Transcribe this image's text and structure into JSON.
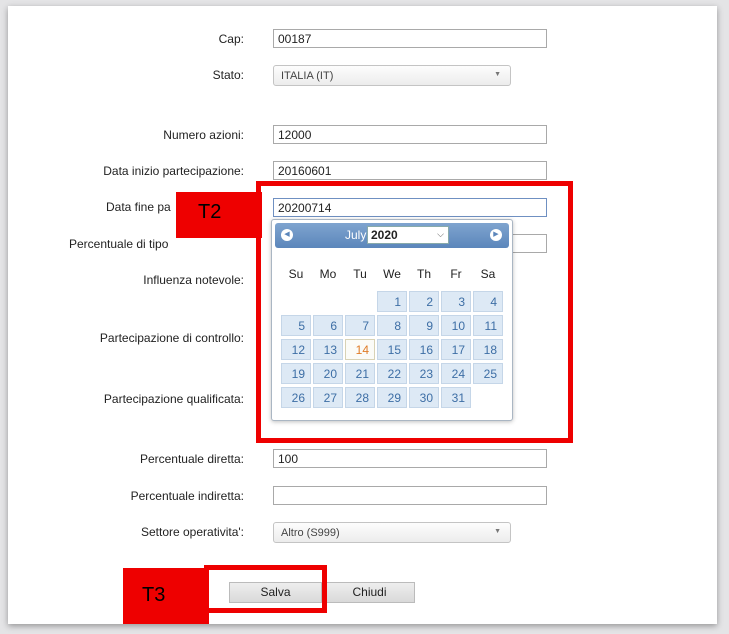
{
  "form": {
    "cap": {
      "label": "Cap:",
      "value": "00187"
    },
    "stato": {
      "label": "Stato:",
      "value": "ITALIA (IT)"
    },
    "numero_azioni": {
      "label": "Numero azioni:",
      "value": "12000"
    },
    "data_inizio": {
      "label": "Data inizio partecipazione:",
      "value": "20160601"
    },
    "data_fine": {
      "label": "Data fine pa",
      "value": "20200714"
    },
    "percentuale_tipo": {
      "label": "Percentuale di tipo"
    },
    "influenza": {
      "label": "Influenza notevole:"
    },
    "controllo": {
      "label": "Partecipazione di controllo:"
    },
    "qualificata": {
      "label": "Partecipazione qualificata:"
    },
    "perc_diretta": {
      "label": "Percentuale diretta:",
      "value": "100"
    },
    "perc_indiretta": {
      "label": "Percentuale indiretta:",
      "value": ""
    },
    "settore": {
      "label": "Settore operativita':",
      "value": "Altro (S999)"
    }
  },
  "buttons": {
    "save": "Salva",
    "close": "Chiudi"
  },
  "annotations": {
    "t2": "T2",
    "t3": "T3",
    "color": "#ee0000"
  },
  "datepicker": {
    "month": "July",
    "year": "2020",
    "weekdays": [
      "Su",
      "Mo",
      "Tu",
      "We",
      "Th",
      "Fr",
      "Sa"
    ],
    "weeks": [
      [
        null,
        null,
        null,
        1,
        2,
        3,
        4
      ],
      [
        5,
        6,
        7,
        8,
        9,
        10,
        11
      ],
      [
        12,
        13,
        14,
        15,
        16,
        17,
        18
      ],
      [
        19,
        20,
        21,
        22,
        23,
        24,
        25
      ],
      [
        26,
        27,
        28,
        29,
        30,
        31,
        null
      ]
    ],
    "today": 14,
    "prev_icon": "circle-arrow-left-icon",
    "next_icon": "circle-arrow-right-icon",
    "header_color": "#5b86bb",
    "today_color": "#e07b27"
  }
}
